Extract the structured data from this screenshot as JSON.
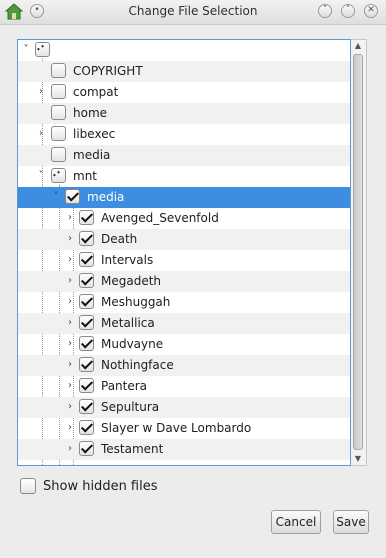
{
  "window": {
    "title": "Change File Selection",
    "icons": [
      "home-icon",
      "menu-icon",
      "chevron-down-icon",
      "chevron-up-icon",
      "close-icon"
    ]
  },
  "tree": {
    "root": {
      "state": "partial"
    },
    "items": [
      {
        "label": "COPYRIGHT",
        "expandable": false,
        "checked": false
      },
      {
        "label": "compat",
        "expandable": true,
        "checked": false
      },
      {
        "label": "home",
        "expandable": false,
        "checked": false
      },
      {
        "label": "libexec",
        "expandable": true,
        "checked": false
      },
      {
        "label": "media",
        "expandable": false,
        "checked": false
      },
      {
        "label": "mnt",
        "expandable": true,
        "expanded": true,
        "state": "partial"
      },
      {
        "label": "media",
        "expandable": true,
        "expanded": true,
        "checked": true,
        "selected": true
      },
      {
        "label": "Avenged_Sevenfold",
        "expandable": true,
        "checked": true
      },
      {
        "label": "Death",
        "expandable": true,
        "checked": true
      },
      {
        "label": "Intervals",
        "expandable": true,
        "checked": true
      },
      {
        "label": "Megadeth",
        "expandable": true,
        "checked": true
      },
      {
        "label": "Meshuggah",
        "expandable": true,
        "checked": true
      },
      {
        "label": "Metallica",
        "expandable": true,
        "checked": true
      },
      {
        "label": "Mudvayne",
        "expandable": true,
        "checked": true
      },
      {
        "label": "Nothingface",
        "expandable": true,
        "checked": true
      },
      {
        "label": "Pantera",
        "expandable": true,
        "checked": true
      },
      {
        "label": "Sepultura",
        "expandable": true,
        "checked": true
      },
      {
        "label": "Slayer w Dave Lombardo",
        "expandable": true,
        "checked": true
      },
      {
        "label": "Testament",
        "expandable": true,
        "checked": true
      }
    ]
  },
  "options": {
    "show_hidden_label": "Show hidden files",
    "show_hidden_checked": false
  },
  "buttons": {
    "cancel": "Cancel",
    "save": "Save"
  },
  "colors": {
    "selection": "#3d8ee0",
    "focus_border": "#5b9bd5"
  }
}
